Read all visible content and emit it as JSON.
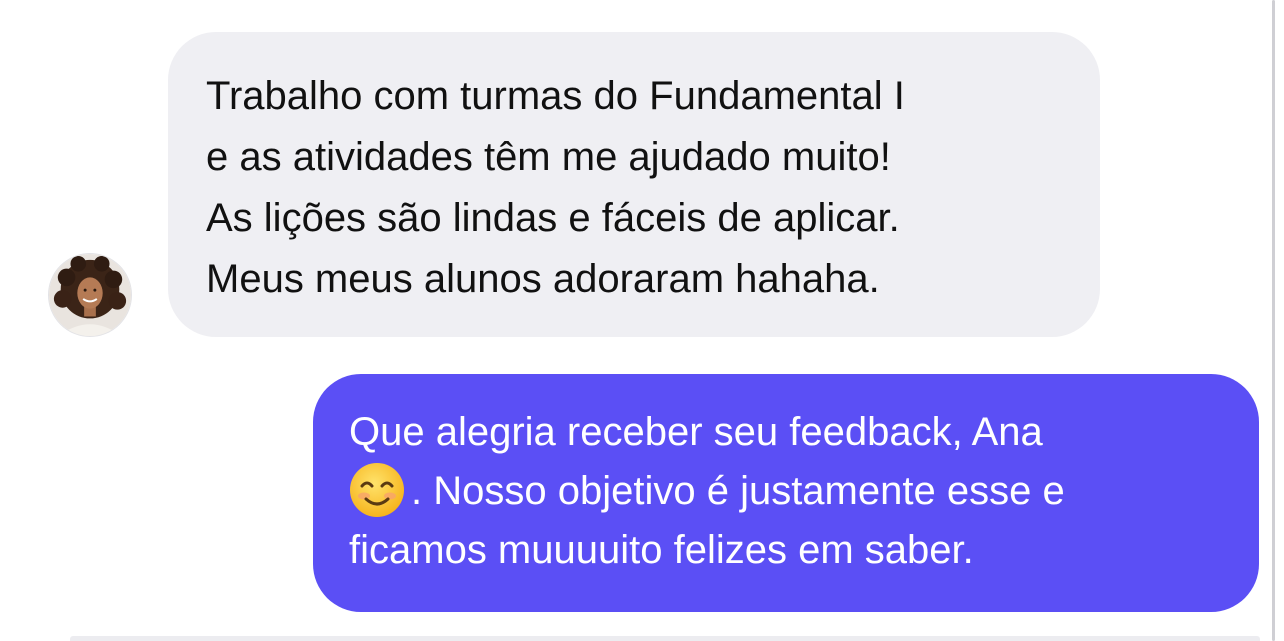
{
  "conversation": {
    "received": {
      "avatar": "avatar-woman-curly-hair",
      "bubble_color": "#efeff3",
      "lines": [
        "Trabalho com turmas do Fundamental I",
        "e as atividades têm me ajudado muito!",
        "As lições são lindas e fáceis de aplicar.",
        "Meus meus alunos adoraram hahaha."
      ]
    },
    "sent": {
      "bubble_color": "#5b4ff5",
      "line1": "Que alegria receber seu feedback, Ana",
      "line2_emoji": "smiling-face-emoji",
      "line2_text": ". Nosso objetivo é justamente esse e",
      "line3": "ficamos muuuuito felizes em saber."
    }
  }
}
